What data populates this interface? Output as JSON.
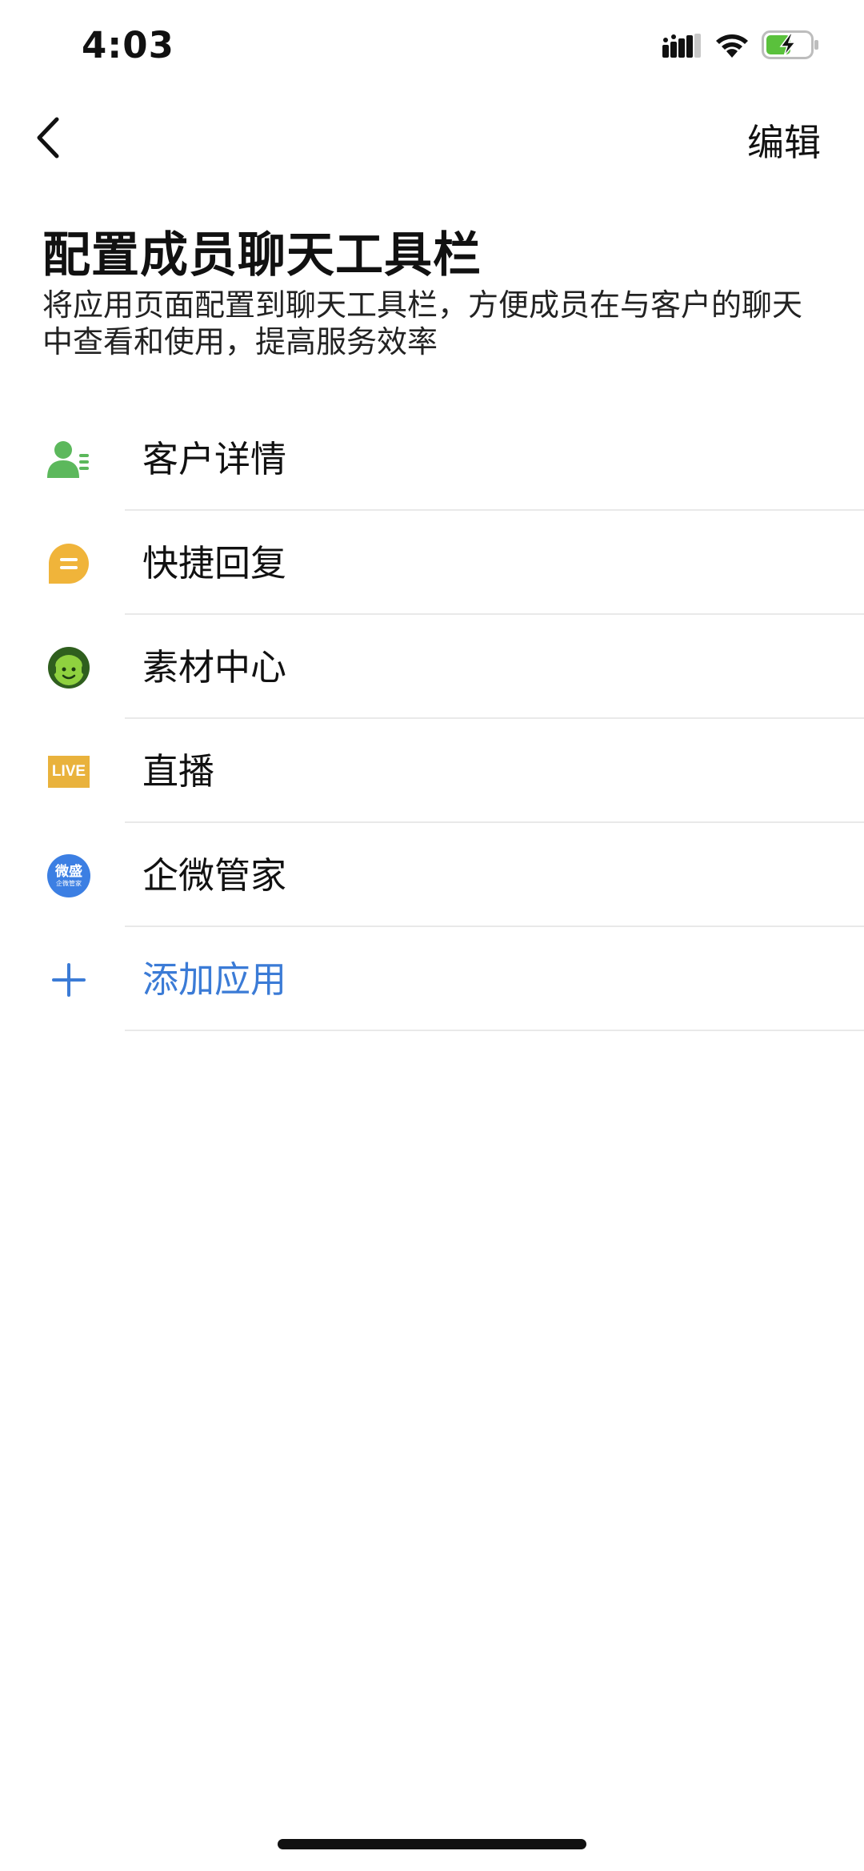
{
  "status_bar": {
    "time": "4:03",
    "icons": [
      "signal-icon",
      "wifi-icon",
      "battery-charging-icon"
    ],
    "battery_color": "#5ac13c"
  },
  "nav": {
    "back_icon": "chevron-left-icon",
    "edit_label": "编辑"
  },
  "header": {
    "title": "配置成员聊天工具栏",
    "description": "将应用页面配置到聊天工具栏，方便成员在与客户的聊天中查看和使用，提高服务效率"
  },
  "tools": [
    {
      "label": "客户详情",
      "icon": "customer-detail-icon",
      "color": "#5cb85c"
    },
    {
      "label": "快捷回复",
      "icon": "quick-reply-icon",
      "color": "#f0b43a"
    },
    {
      "label": "素材中心",
      "icon": "material-center-icon",
      "color": "#8fd13f"
    },
    {
      "label": "直播",
      "icon": "live-icon",
      "badge_text": "LIVE",
      "color": "#e9b23c"
    },
    {
      "label": "企微管家",
      "icon": "weisheng-icon",
      "badge_text": "微盛",
      "badge_sub": "企微管家",
      "color": "#3c7fe3"
    }
  ],
  "add_app": {
    "label": "添加应用",
    "icon": "plus-icon",
    "color": "#3b7bd6"
  }
}
